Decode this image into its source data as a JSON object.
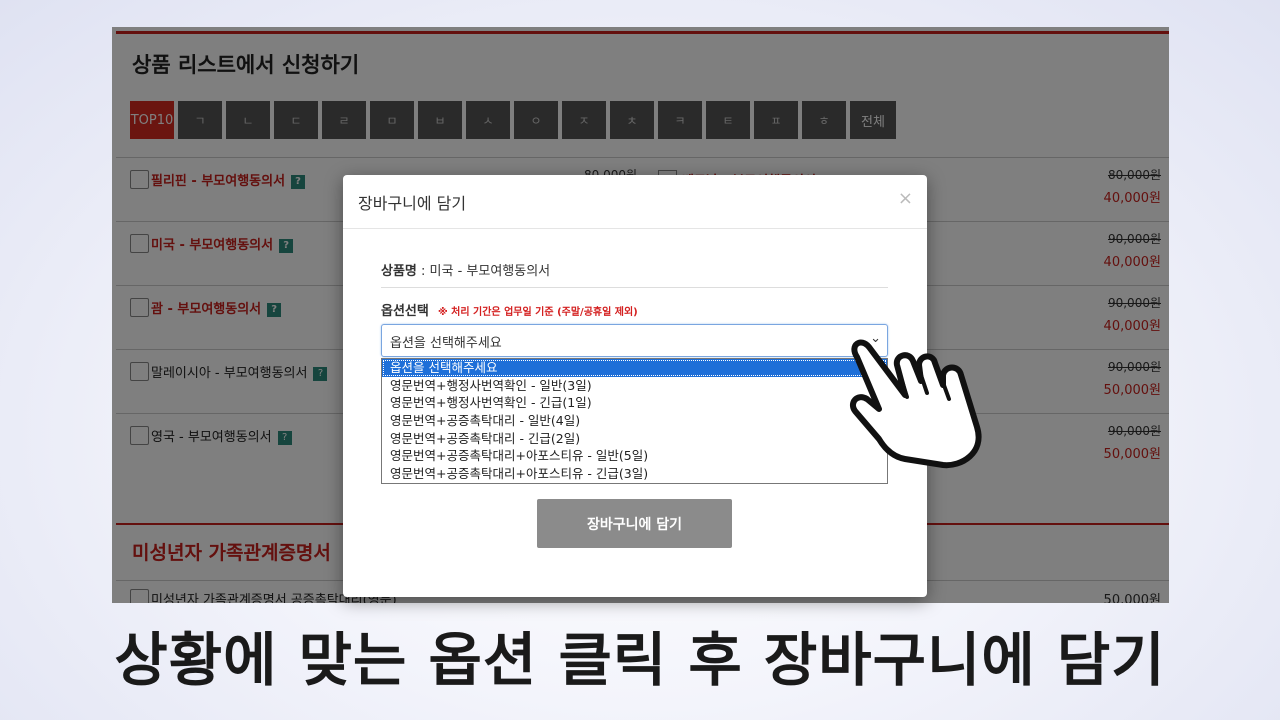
{
  "page": {
    "section_title": "상품 리스트에서 신청하기",
    "tabs": [
      "TOP10",
      "ㄱ",
      "ㄴ",
      "ㄷ",
      "ㄹ",
      "ㅁ",
      "ㅂ",
      "ㅅ",
      "ㅇ",
      "ㅈ",
      "ㅊ",
      "ㅋ",
      "ㅌ",
      "ㅍ",
      "ㅎ",
      "전체"
    ],
    "products": [
      {
        "name": "필리핀 - 부모여행동의서",
        "original": "80,000원",
        "price": "40,000원"
      },
      {
        "name": "미국 - 부모여행동의서",
        "original": "90,000원",
        "price": "40,000원"
      },
      {
        "name": "괌 - 부모여행동의서",
        "original": "90,000원",
        "price": "40,000원"
      },
      {
        "name": "말레이시아 - 부모여행동의서",
        "original": "90,000원",
        "price": "50,000원"
      },
      {
        "name": "영국 - 부모여행동의서",
        "original": "90,000원",
        "price": "50,000원"
      }
    ],
    "mid_price": "80,000원",
    "mid_name": "베트남 - 부모여행동의서",
    "section2_title": "미성년자 가족관계증명서",
    "section2_row": {
      "name": "미성년자 가족관계증명서 공증촉탁대리(영문)",
      "price": "50,000원"
    },
    "help_label": "?"
  },
  "modal": {
    "title": "장바구니에 담기",
    "close": "×",
    "product_label": "상품명",
    "product_value": " : 미국 - 부모여행동의서",
    "option_label": "옵션선택",
    "option_note": "※ 처리 기간은 업무일 기준 (주말/공휴일 제외)",
    "select_value": "옵션을 선택해주세요",
    "options": [
      "옵션을 선택해주세요",
      "영문번역+행정사번역확인 - 일반(3일)",
      "영문번역+행정사번역확인 - 긴급(1일)",
      "영문번역+공증촉탁대리 - 일반(4일)",
      "영문번역+공증촉탁대리 - 긴급(2일)",
      "영문번역+공증촉탁대리+아포스티유 - 일반(5일)",
      "영문번역+공증촉탁대리+아포스티유 - 긴급(3일)"
    ],
    "selected_index": 0,
    "submit": "장바구니에 담기"
  },
  "caption": "상황에 맞는 옵션 클릭 후 장바구니에 담기",
  "icons": {
    "cursor": "pointing-hand-icon",
    "dropdown": "chevron-down-icon"
  },
  "colors": {
    "accent": "#c8211d",
    "selected": "#1e6fd8"
  }
}
